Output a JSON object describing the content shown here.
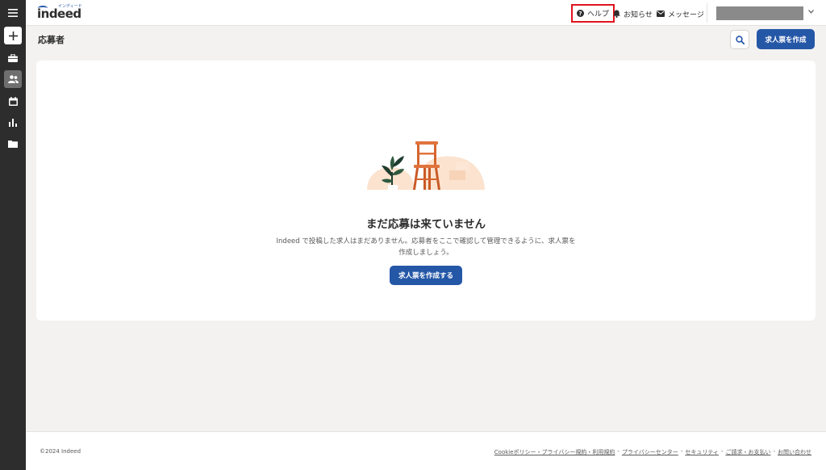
{
  "header": {
    "logo_text": "indeed",
    "logo_sub": "インディード",
    "help_label": "ヘルプ",
    "notifications_label": "お知らせ",
    "messages_label": "メッセージ"
  },
  "page": {
    "title": "応募者",
    "create_job_label": "求人票を作成"
  },
  "empty_state": {
    "title": "まだ応募は来ていません",
    "description": "Indeed で投稿した求人はまだありません。応募者をここで確認して管理できるように、求人票を作成しましょう。",
    "cta_label": "求人票を作成する"
  },
  "sidebar": {
    "items": [
      {
        "icon": "menu-icon"
      },
      {
        "icon": "plus-icon"
      },
      {
        "icon": "briefcase-icon"
      },
      {
        "icon": "people-icon",
        "active": true
      },
      {
        "icon": "calendar-icon"
      },
      {
        "icon": "bar-chart-icon"
      },
      {
        "icon": "folder-icon"
      }
    ]
  },
  "footer": {
    "copyright": "©2024 Indeed",
    "links": [
      "Cookieポリシー・プライバシー規約・利用規約",
      "プライバシーセンター",
      "セキュリティ",
      "ご請求・お支払い",
      "お問い合わせ"
    ],
    "separator": "-"
  },
  "colors": {
    "brand_blue": "#2557a7",
    "rail_bg": "#2d2d2d",
    "page_bg": "#f3f2f1",
    "highlight_red": "#e0141e"
  }
}
